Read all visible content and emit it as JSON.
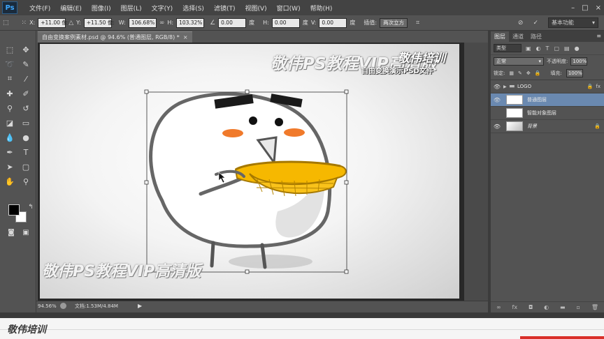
{
  "app": {
    "logo": "Ps",
    "menus": [
      "文件(F)",
      "编辑(E)",
      "图像(I)",
      "图层(L)",
      "文字(Y)",
      "选择(S)",
      "滤镜(T)",
      "视图(V)",
      "窗口(W)",
      "帮助(H)"
    ],
    "window_controls": [
      "–",
      "□",
      "×"
    ]
  },
  "options": {
    "x_label": "X:",
    "x_value": "+11.00 像:",
    "y_label": "Y:",
    "y_value": "+11.50 像:",
    "w_label": "W:",
    "w_value": "106.68%",
    "h_label": "H:",
    "h_value": "103.32%",
    "angle_value": "0.00",
    "angle_unit": "度",
    "hskew_label": "H:",
    "hskew_value": "0.00",
    "hskew_unit": "度",
    "vskew_label": "V:",
    "vskew_value": "0.00",
    "vskew_unit": "度",
    "interp_label": "插值:",
    "interp_value": "两次立方",
    "workspace": "基本功能"
  },
  "document": {
    "tab_title": "自由变换案例素材.psd @ 94.6% (普通图层, RGB/8) *",
    "close": "×"
  },
  "canvas": {
    "watermark_top": "敬伟PS教程VIP高清版",
    "watermark_brand": "敬伟培训",
    "watermark_sub": "自由变换演示PSD文件",
    "watermark_bottom": "敬伟PS教程VIP高清版"
  },
  "status": {
    "zoom": "94.56%",
    "doc_info": "文档:1.53M/4.84M",
    "arrow": "▶"
  },
  "panels": {
    "tabs": [
      "图层",
      "通道",
      "路径"
    ],
    "filter_kind": "类型",
    "blend_mode": "正常",
    "opacity_label": "不透明度:",
    "opacity_value": "100%",
    "lock_label": "锁定:",
    "fill_label": "填充:",
    "fill_value": "100%",
    "layers": [
      {
        "name": "LOGO",
        "type": "group",
        "visible": true,
        "selected": false
      },
      {
        "name": "普通图层",
        "type": "pixel",
        "visible": true,
        "selected": true
      },
      {
        "name": "智能对象图层",
        "type": "smart",
        "visible": false,
        "selected": false
      },
      {
        "name": "背景",
        "type": "background",
        "visible": true,
        "selected": false
      }
    ]
  },
  "banner": {
    "logo": "敬伟培训"
  },
  "colors": {
    "selected_layer": "#6a89b0",
    "menubar": "#434343",
    "workspace_bg": "#535353",
    "banner_accent": "#d9302a"
  }
}
